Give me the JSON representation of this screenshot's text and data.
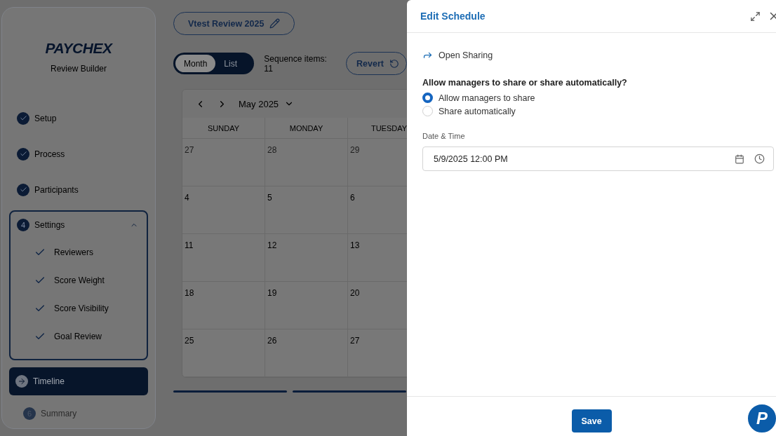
{
  "sidebar": {
    "logo": "PAYCHEX",
    "subtitle": "Review Builder",
    "steps": [
      {
        "kind": "done",
        "label": "Setup"
      },
      {
        "kind": "done",
        "label": "Process"
      },
      {
        "kind": "done",
        "label": "Participants"
      },
      {
        "kind": "group",
        "number": "4",
        "label": "Settings",
        "expanded": true,
        "children": [
          {
            "label": "Reviewers",
            "checked": true
          },
          {
            "label": "Score Weight",
            "checked": true
          },
          {
            "label": "Score Visibility",
            "checked": true
          },
          {
            "label": "Goal Review",
            "checked": true
          }
        ]
      },
      {
        "kind": "current",
        "label": "Timeline",
        "selected": true
      },
      {
        "kind": "pending",
        "number": "6",
        "label": "Summary",
        "disabled": true
      }
    ]
  },
  "review_title": "Vtest Review 2025",
  "view_toggle": [
    {
      "label": "Month",
      "selected": true
    },
    {
      "label": "List",
      "selected": false
    }
  ],
  "sequence_items": "Sequence items: 11",
  "revert_button": "Revert",
  "calendar": {
    "month": "May 2025",
    "weekdays": [
      "SUNDAY",
      "MONDAY",
      "TUESDAY"
    ],
    "weeks": [
      [
        {
          "day": "27",
          "outside": true
        },
        {
          "day": "28",
          "outside": true
        },
        {
          "day": "29",
          "outside": true
        }
      ],
      [
        {
          "day": "4",
          "outside": false
        },
        {
          "day": "5",
          "outside": false
        },
        {
          "day": "6",
          "outside": false
        }
      ],
      [
        {
          "day": "11",
          "outside": false
        },
        {
          "day": "12",
          "outside": false
        },
        {
          "day": "13",
          "outside": false
        }
      ],
      [
        {
          "day": "18",
          "outside": false
        },
        {
          "day": "19",
          "outside": false
        },
        {
          "day": "20",
          "outside": false
        }
      ],
      [
        {
          "day": "25",
          "outside": false
        },
        {
          "day": "26",
          "outside": false
        },
        {
          "day": "27",
          "outside": false
        }
      ]
    ]
  },
  "dialog": {
    "title": "Edit Schedule",
    "section": "Open Sharing",
    "question": "Allow managers to share or share automatically?",
    "options": [
      {
        "label": "Allow managers to share",
        "selected": true
      },
      {
        "label": "Share automatically",
        "selected": false
      }
    ],
    "field_label": "Date & Time",
    "field_value": "5/9/2025 12:00 PM",
    "save_button": "Save"
  },
  "help_badge": "P"
}
